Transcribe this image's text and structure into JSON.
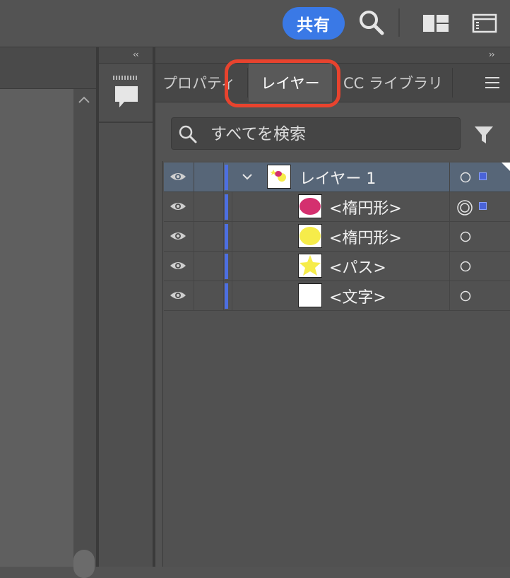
{
  "topbar": {
    "share_label": "共有",
    "icons": [
      "search-icon",
      "workspace-switcher-icon",
      "panel-toggle-icon"
    ]
  },
  "panel": {
    "collapse_left": "‹‹",
    "collapse_right": "››",
    "tabs": [
      {
        "label": "プロパティ",
        "active": false
      },
      {
        "label": "レイヤー",
        "active": true
      },
      {
        "label": "CC ライブラリ",
        "active": false
      }
    ],
    "search_placeholder": "すべてを検索",
    "layers": [
      {
        "name": "レイヤー 1",
        "level": 0,
        "selected": true,
        "expanded": true,
        "thumbnail": "layer-thumbnail"
      },
      {
        "name": "<楕円形>",
        "level": 1,
        "thumbnail": "magenta-ellipse",
        "targeted": true,
        "fill": "#d4306f"
      },
      {
        "name": "<楕円形>",
        "level": 1,
        "thumbnail": "yellow-ellipse",
        "fill": "#f6ec4a"
      },
      {
        "name": "<パス>",
        "level": 1,
        "thumbnail": "yellow-star",
        "fill": "#f6ec4a"
      },
      {
        "name": "<文字>",
        "level": 1,
        "thumbnail": "blank"
      }
    ]
  },
  "colors": {
    "accent": "#3a79e6",
    "highlight": "#e8432e",
    "layer_color": "#4d6fe0",
    "selected_row": "#576678"
  }
}
